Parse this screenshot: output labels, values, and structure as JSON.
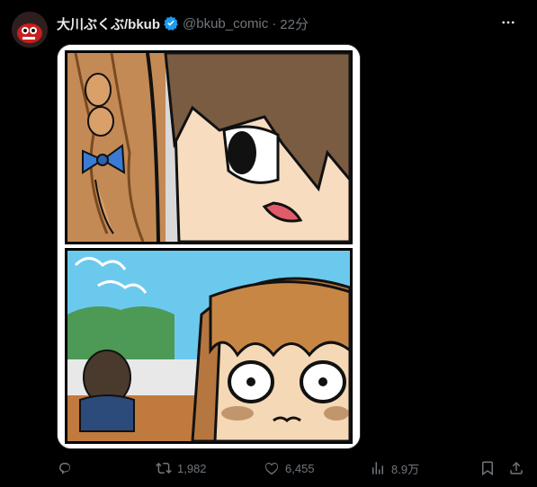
{
  "post": {
    "display_name": "大川ぶくぶ/bkub",
    "handle": "@bkub_comic",
    "separator": "·",
    "time": "22分",
    "verified": true
  },
  "metrics": {
    "replies": "",
    "reposts": "1,982",
    "likes": "6,455",
    "views": "8.9万"
  },
  "icons": {
    "reply": "reply-icon",
    "repost": "repost-icon",
    "like": "heart-icon",
    "views": "views-icon",
    "bookmark": "bookmark-icon",
    "share": "share-icon",
    "more": "more-icon",
    "verified": "verified-badge-icon"
  },
  "colors": {
    "background": "#000000",
    "text": "#e7e9ea",
    "muted": "#71767b",
    "verified": "#1d9bf0"
  }
}
